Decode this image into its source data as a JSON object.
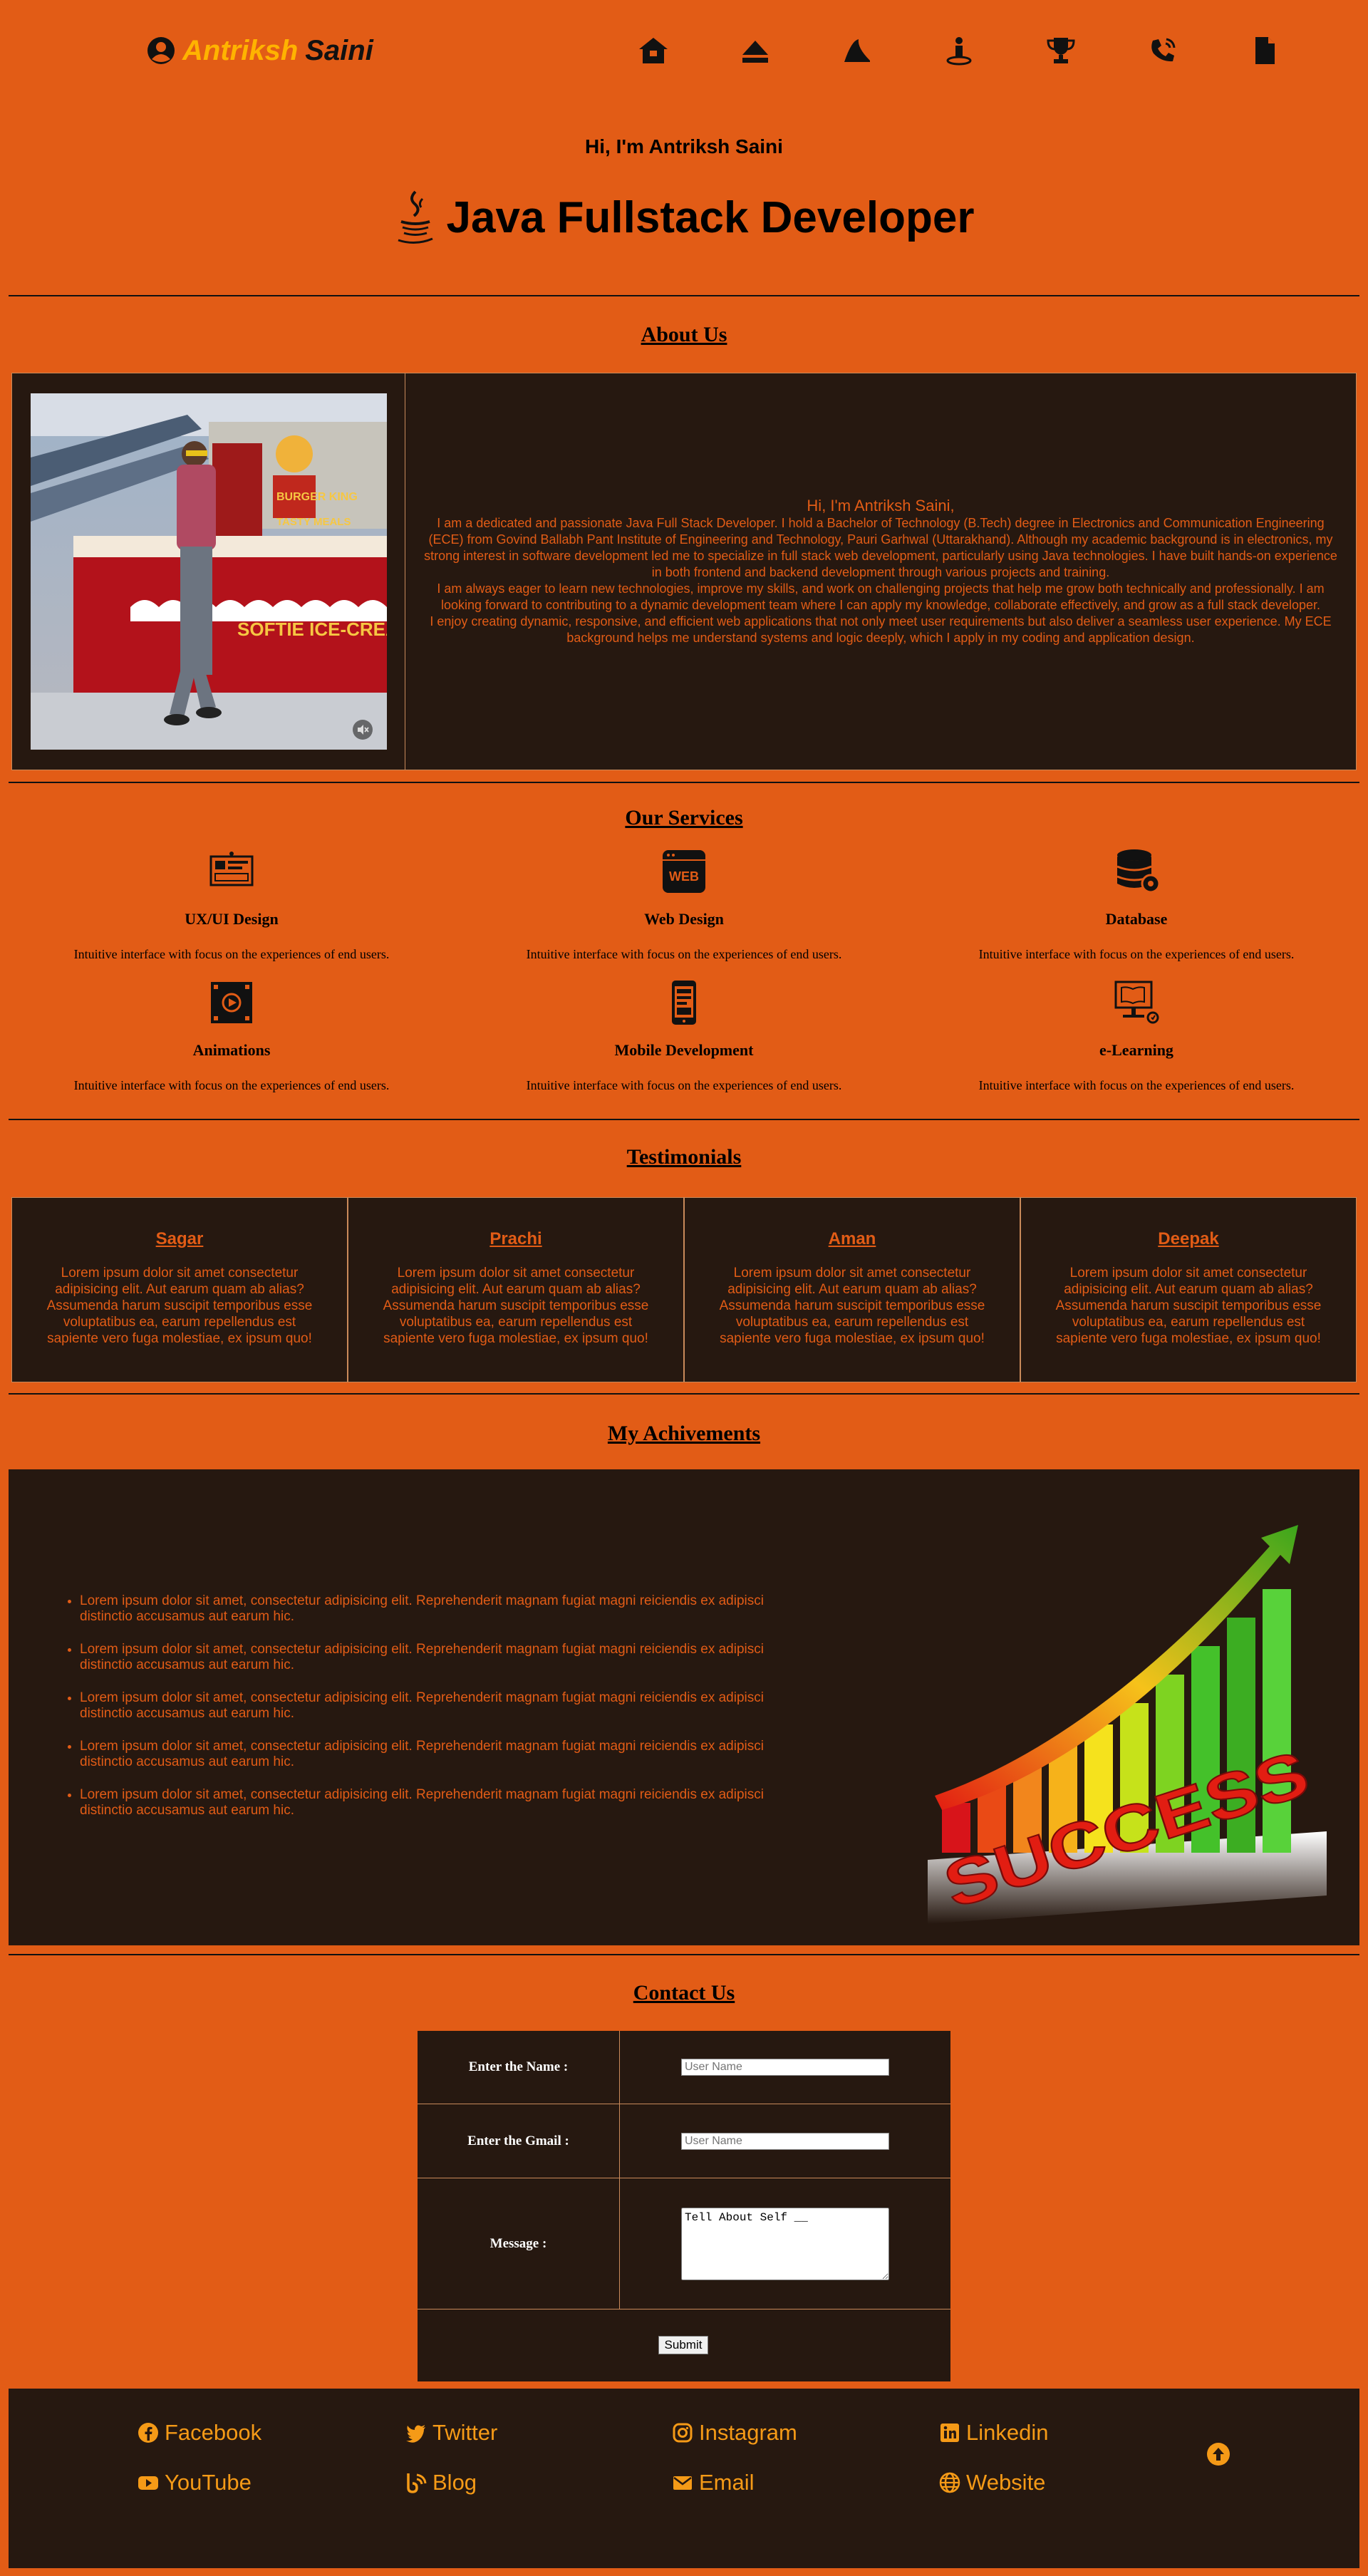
{
  "nav": {
    "brand_first": "Antriksh",
    "brand_last": "Saini",
    "icons": [
      "home-icon",
      "eject-icon",
      "shark-fin-icon",
      "person-icon",
      "trophy-icon",
      "phone-icon",
      "file-icon"
    ]
  },
  "hero": {
    "greeting": "Hi, I'm Antriksh Saini",
    "role": "Java Fullstack Developer"
  },
  "about": {
    "title": "About Us",
    "greeting": "Hi, I'm Antriksh Saini,",
    "p1": "I am a dedicated and passionate Java Full Stack Developer. I hold a Bachelor of Technology (B.Tech) degree in Electronics and Communication Engineering (ECE) from Govind Ballabh Pant Institute of Engineering and Technology, Pauri Garhwal (Uttarakhand). Although my academic background is in electronics, my strong interest in software development led me to specialize in full stack web development, particularly using Java technologies. I have built hands-on experience in both frontend and backend development through various projects and training.",
    "p2": "I am always eager to learn new technologies, improve my skills, and work on challenging projects that help me grow both technically and professionally. I am looking forward to contributing to a dynamic development team where I can apply my knowledge, collaborate effectively, and grow as a full stack developer.",
    "p3": "I enjoy creating dynamic, responsive, and efficient web applications that not only meet user requirements but also deliver a seamless user experience. My ECE background helps me understand systems and logic deeply, which I apply in my coding and application design.",
    "photo_sign_top": "BURGER KING",
    "photo_sign_mid": "TASTY MEALS",
    "photo_counter_text": "SOFTIE ICE-CREAM"
  },
  "services": {
    "title": "Our Services",
    "items": [
      {
        "name": "UX/UI Design",
        "desc": "Intuitive interface with focus on the experiences of end users.",
        "icon": "ux-design-icon"
      },
      {
        "name": "Web Design",
        "desc": "Intuitive interface with focus on the experiences of end users.",
        "icon": "web-icon"
      },
      {
        "name": "Database",
        "desc": "Intuitive interface with focus on the experiences of end users.",
        "icon": "database-icon"
      },
      {
        "name": "Animations",
        "desc": "Intuitive interface with focus on the experiences of end users.",
        "icon": "animation-icon"
      },
      {
        "name": "Mobile Development",
        "desc": "Intuitive interface with focus on the experiences of end users.",
        "icon": "mobile-icon"
      },
      {
        "name": "e-Learning",
        "desc": "Intuitive interface with focus on the experiences of end users.",
        "icon": "elearning-icon"
      }
    ],
    "web_badge": "WEB"
  },
  "testimonials": {
    "title": "Testimonials",
    "items": [
      {
        "name": "Sagar",
        "quote": "Lorem ipsum dolor sit amet consectetur adipisicing elit. Aut earum quam ab alias? Assumenda harum suscipit temporibus esse voluptatibus ea, earum repellendus est sapiente vero fuga molestiae, ex ipsum quo!"
      },
      {
        "name": "Prachi",
        "quote": "Lorem ipsum dolor sit amet consectetur adipisicing elit. Aut earum quam ab alias? Assumenda harum suscipit temporibus esse voluptatibus ea, earum repellendus est sapiente vero fuga molestiae, ex ipsum quo!"
      },
      {
        "name": "Aman",
        "quote": "Lorem ipsum dolor sit amet consectetur adipisicing elit. Aut earum quam ab alias? Assumenda harum suscipit temporibus esse voluptatibus ea, earum repellendus est sapiente vero fuga molestiae, ex ipsum quo!"
      },
      {
        "name": "Deepak",
        "quote": "Lorem ipsum dolor sit amet consectetur adipisicing elit. Aut earum quam ab alias? Assumenda harum suscipit temporibus esse voluptatibus ea, earum repellendus est sapiente vero fuga molestiae, ex ipsum quo!"
      }
    ]
  },
  "achievements": {
    "title": "My Achivements",
    "items": [
      "Lorem ipsum dolor sit amet, consectetur adipisicing elit. Reprehenderit magnam fugiat magni reiciendis ex adipisci distinctio accusamus aut earum hic.",
      "Lorem ipsum dolor sit amet, consectetur adipisicing elit. Reprehenderit magnam fugiat magni reiciendis ex adipisci distinctio accusamus aut earum hic.",
      "Lorem ipsum dolor sit amet, consectetur adipisicing elit. Reprehenderit magnam fugiat magni reiciendis ex adipisci distinctio accusamus aut earum hic.",
      "Lorem ipsum dolor sit amet, consectetur adipisicing elit. Reprehenderit magnam fugiat magni reiciendis ex adipisci distinctio accusamus aut earum hic.",
      "Lorem ipsum dolor sit amet, consectetur adipisicing elit. Reprehenderit magnam fugiat magni reiciendis ex adipisci distinctio accusamus aut earum hic."
    ],
    "image_text": "SUCCESS"
  },
  "contact": {
    "title": "Contact Us",
    "name_label": "Enter the Name :",
    "name_placeholder": "User Name",
    "gmail_label": "Enter the Gmail :",
    "gmail_placeholder": "User Name",
    "message_label": "Message :",
    "message_value": "Tell About Self __",
    "submit_label": "Submit"
  },
  "footer": {
    "links": [
      {
        "label": "Facebook",
        "icon": "facebook-icon"
      },
      {
        "label": "Twitter",
        "icon": "twitter-icon"
      },
      {
        "label": "Instagram",
        "icon": "instagram-icon"
      },
      {
        "label": "Linkedin",
        "icon": "linkedin-icon"
      },
      {
        "label": "YouTube",
        "icon": "youtube-icon"
      },
      {
        "label": "Blog",
        "icon": "blog-icon"
      },
      {
        "label": "Email",
        "icon": "email-icon"
      },
      {
        "label": "Website",
        "icon": "globe-icon"
      }
    ],
    "totop_icon": "arrow-up-circle-icon"
  },
  "colors": {
    "background": "#e25c16",
    "panel": "#261810",
    "brand_accent": "#ffb300",
    "footer_link": "#f59a17"
  }
}
